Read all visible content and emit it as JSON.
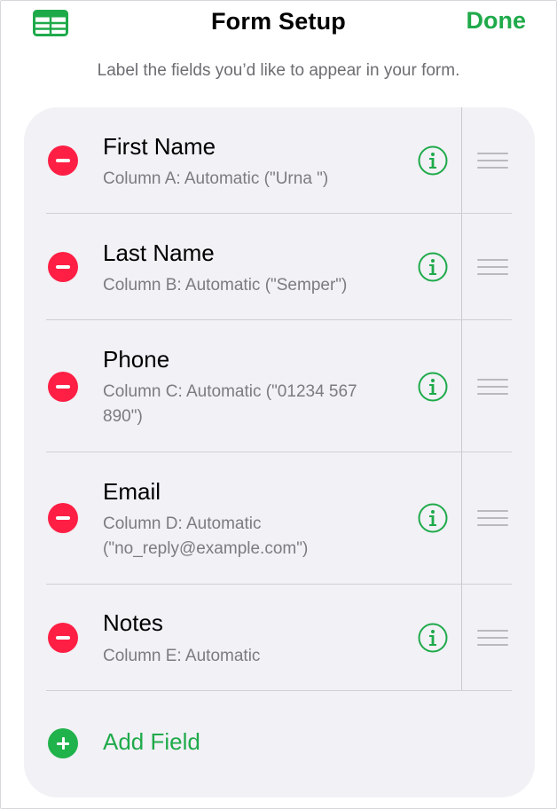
{
  "header": {
    "title": "Form Setup",
    "done_label": "Done",
    "left_icon": "table-icon",
    "subtitle": "Label the fields you’d like to appear in your form."
  },
  "fields": [
    {
      "name": "First Name",
      "description": "Column A: Automatic (\"Urna \")"
    },
    {
      "name": "Last Name",
      "description": "Column B: Automatic (\"Semper\")"
    },
    {
      "name": "Phone",
      "description": "Column C: Automatic (\"01234 567 890\")"
    },
    {
      "name": "Email",
      "description": "Column D: Automatic (\"no_reply@example.com\")"
    },
    {
      "name": "Notes",
      "description": "Column E: Automatic"
    }
  ],
  "add_field": {
    "label": "Add Field"
  },
  "icons": {
    "remove": "minus-circle-icon",
    "info": "info-circle-icon",
    "reorder": "reorder-handle-icon",
    "add": "plus-circle-icon"
  },
  "colors": {
    "accent_green": "#1faa4a",
    "remove_red": "#ff1f44",
    "card_background": "#f1f1f6",
    "secondary_text": "#7b7b80"
  }
}
